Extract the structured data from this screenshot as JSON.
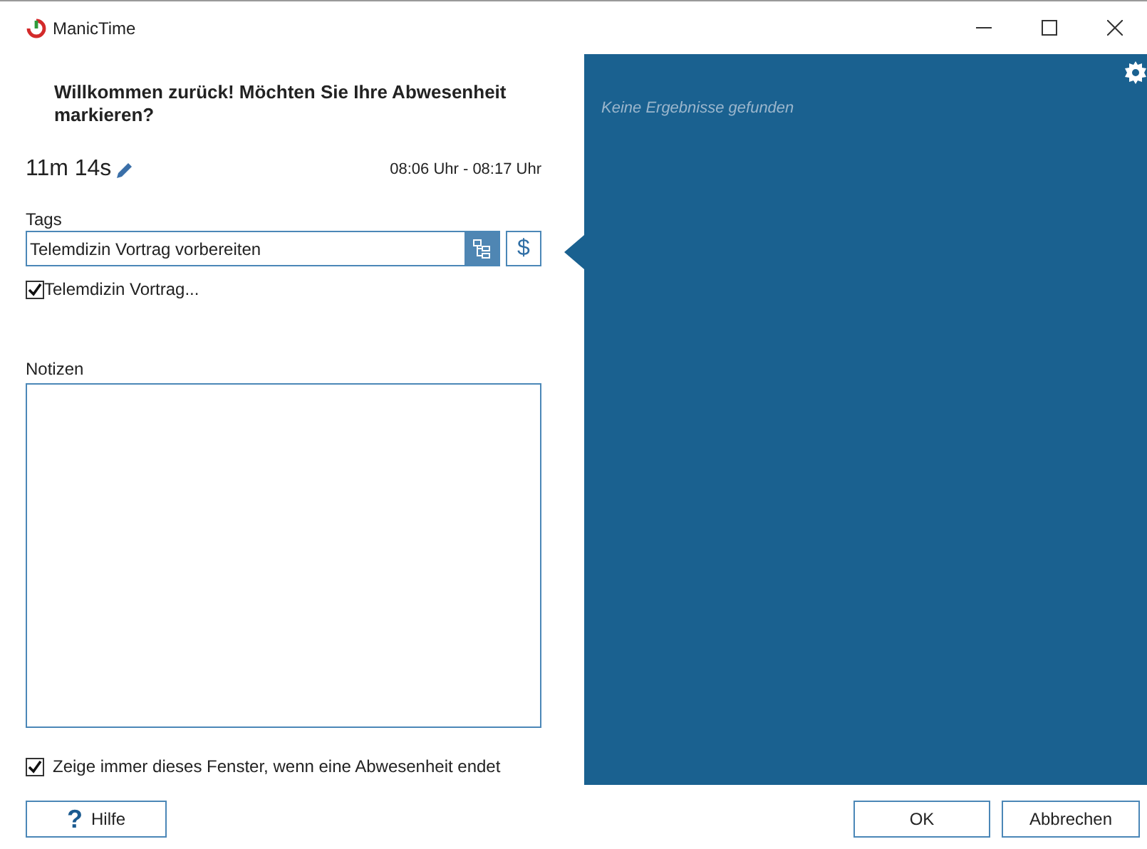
{
  "window": {
    "title": "ManicTime"
  },
  "heading": "Willkommen zurück! Möchten Sie Ihre Abwesenheit markieren?",
  "duration": "11m 14s",
  "time_range": "08:06 Uhr - 08:17 Uhr",
  "tags": {
    "label": "Tags",
    "value": "Telemdizin Vortrag vorbereiten",
    "dollar": "$"
  },
  "tag_items": [
    {
      "label": "Telemdizin Vortrag...",
      "checked": true
    }
  ],
  "notes": {
    "label": "Notizen"
  },
  "results": {
    "empty_text": "Keine Ergebnisse gefunden"
  },
  "always_show": {
    "label": "Zeige immer dieses Fenster, wenn eine Abwesenheit endet",
    "checked": true
  },
  "buttons": {
    "help": {
      "icon": "?",
      "label": "Hilfe"
    },
    "ok": "OK",
    "cancel": "Abbrechen"
  }
}
